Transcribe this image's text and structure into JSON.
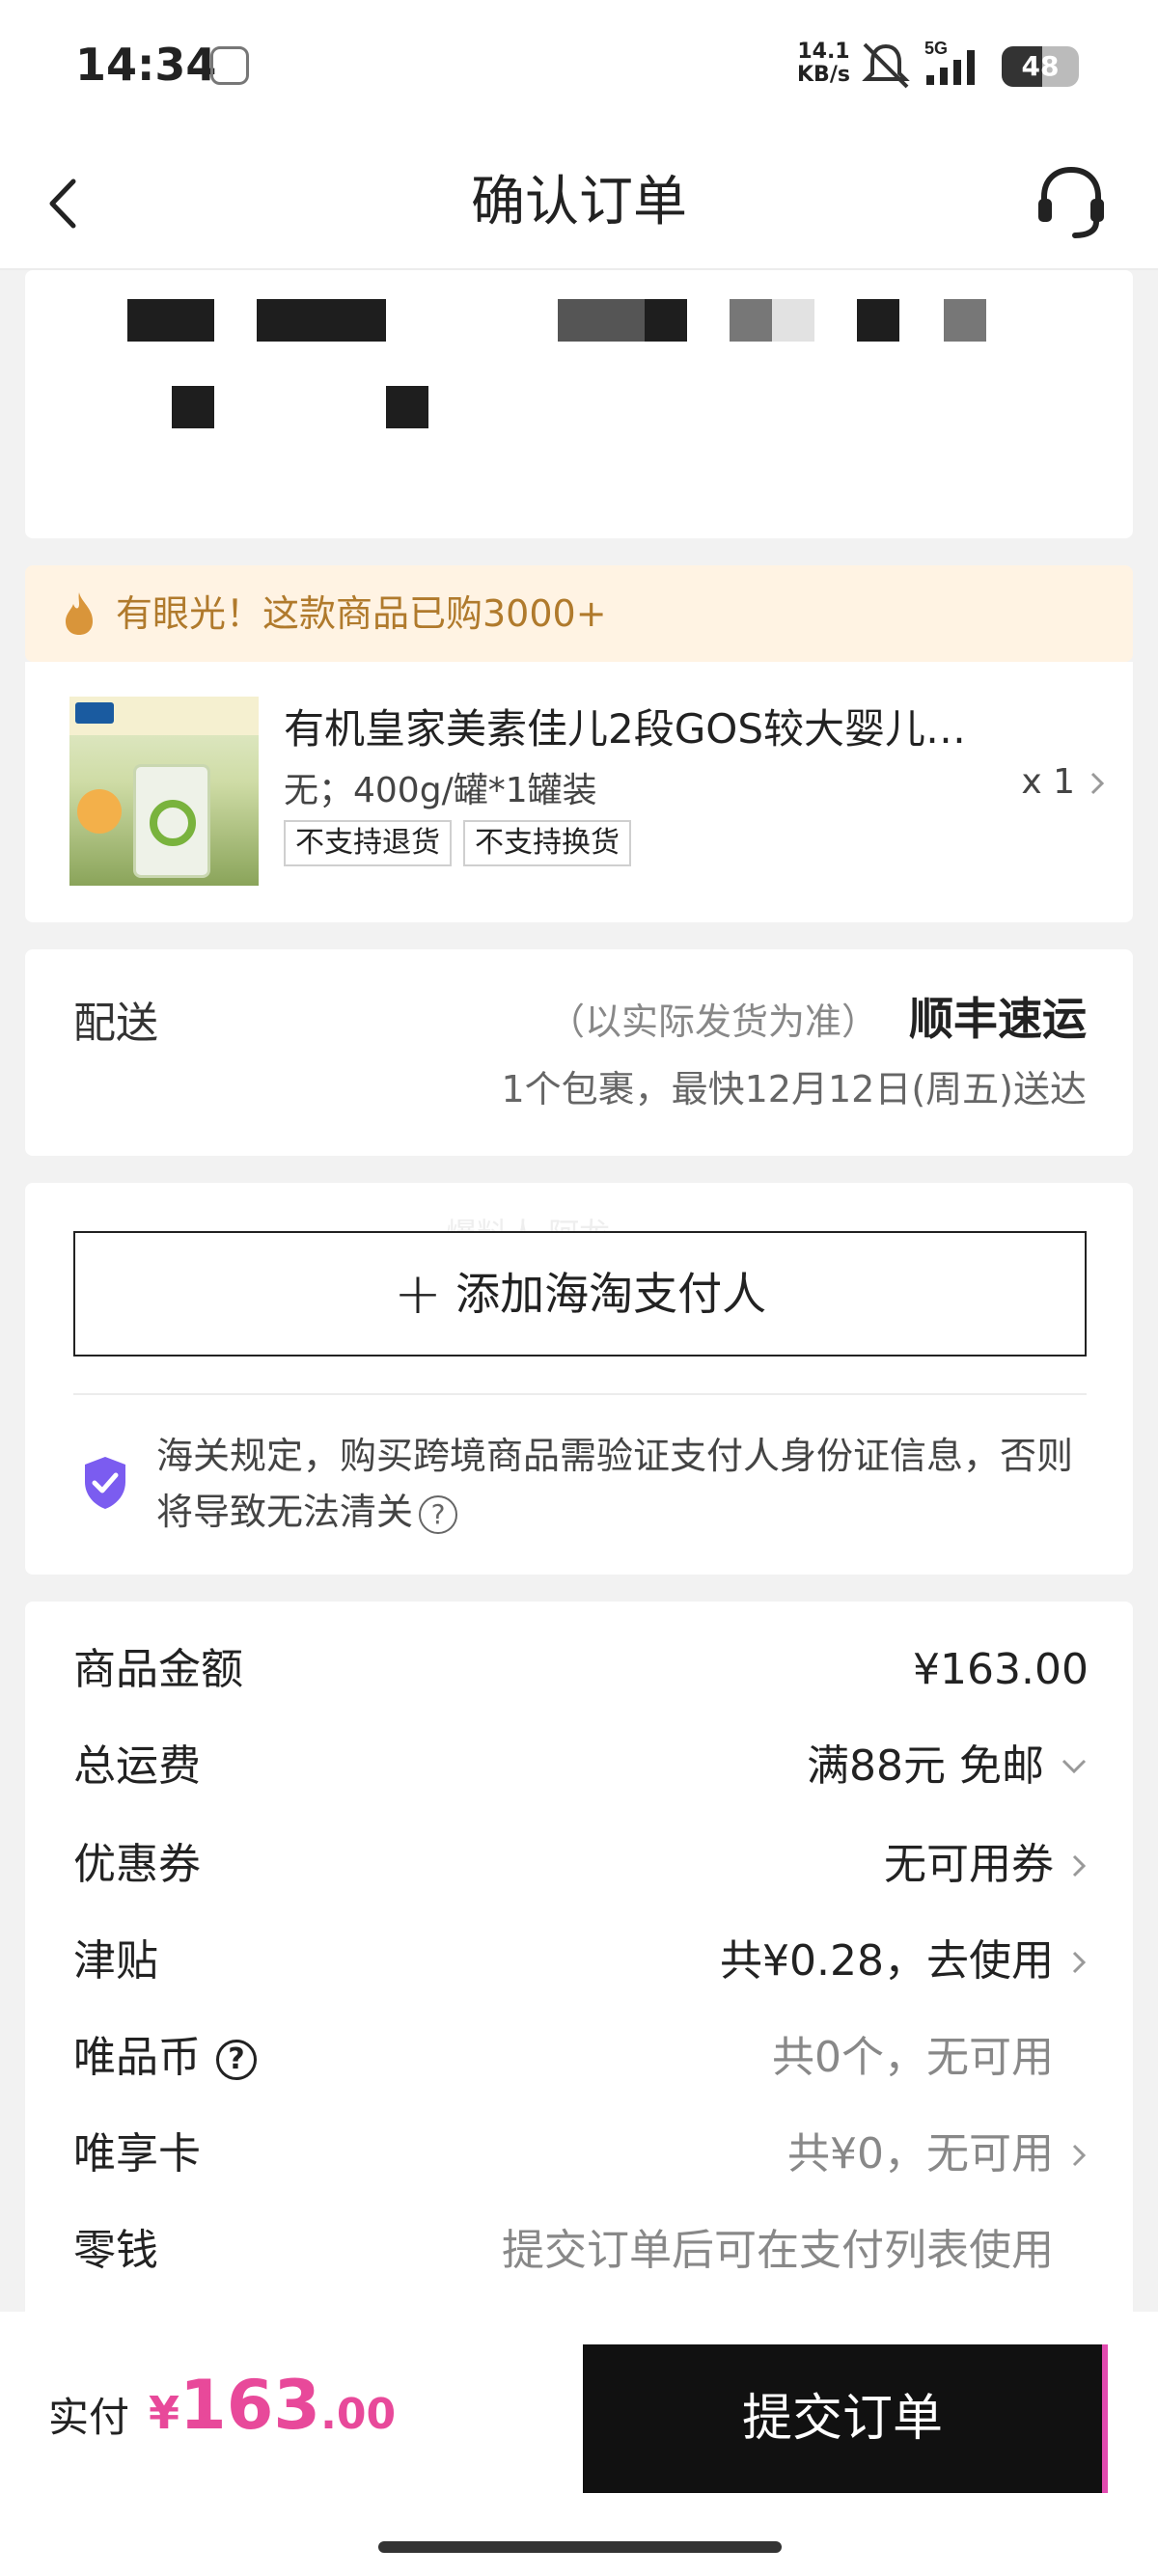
{
  "status_bar": {
    "time": "14:34",
    "net_speed_value": "14.1",
    "net_speed_unit": "KB/s",
    "network": "5G",
    "battery": "48"
  },
  "nav": {
    "title": "确认订单",
    "back_icon": "chevron-left-icon",
    "service_icon": "headset-icon"
  },
  "tip": {
    "text": "有眼光！这款商品已购3000+"
  },
  "product": {
    "title": "有机皇家美素佳儿2段GOS较大婴儿…",
    "spec": "无；400g/罐*1罐装",
    "quantity": "x 1",
    "tags": [
      "不支持退货",
      "不支持换货"
    ]
  },
  "delivery": {
    "label": "配送",
    "note": "（以实际发货为准）",
    "carrier": "顺丰速运",
    "eta": "1个包裹，最快12月12日(周五)送达"
  },
  "payer": {
    "watermark": "爆料人 阿龙",
    "add_button": "添加海淘支付人",
    "plus": "+",
    "customs_notice": "海关规定，购买跨境商品需验证支付人身份证信息，否则将导致无法清关",
    "help": "?"
  },
  "summary": {
    "goods_amount_label": "商品金额",
    "goods_amount_value": "¥163.00",
    "shipping_label": "总运费",
    "shipping_value": "满88元 免邮",
    "coupon_label": "优惠券",
    "coupon_value": "无可用券",
    "subsidy_label": "津贴",
    "subsidy_value": "共¥0.28，去使用",
    "coin_label": "唯品币",
    "coin_help": "?",
    "coin_value": "共0个，无可用",
    "card_label": "唯享卡",
    "card_value": "共¥0，无可用",
    "change_label": "零钱",
    "change_value": "提交订单后可在支付列表使用"
  },
  "bottom": {
    "pay_label": "实付",
    "currency": "¥",
    "amount_int": "163",
    "amount_dec": ".00",
    "submit_label": "提交订单"
  },
  "colors": {
    "accent_pink": "#e8499a",
    "tip_bg": "#fff3e3",
    "tip_text": "#b07a2c",
    "shield": "#7b5cf0"
  }
}
